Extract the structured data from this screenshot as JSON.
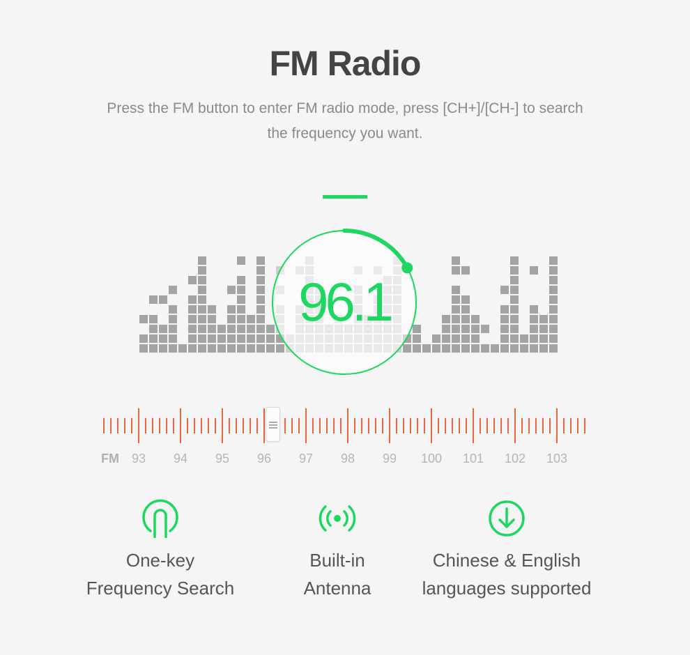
{
  "header": {
    "title": "FM Radio",
    "subtitle": "Press the FM button to enter FM radio mode, press [CH+]/[CH-] to search the frequency you want."
  },
  "colors": {
    "accent_green": "#1ed760",
    "tick_orange": "#e8643a",
    "bar_gray": "#a3a3a3",
    "bar_faded": "#cfcfcf"
  },
  "equalizer": {
    "columns": [
      [
        0,
        1,
        3
      ],
      [
        0,
        1,
        2,
        3,
        5
      ],
      [
        0,
        1,
        2,
        5
      ],
      [
        0,
        1,
        2,
        3,
        4,
        6
      ],
      [
        0
      ],
      [
        0,
        1,
        2,
        3,
        4,
        5,
        7
      ],
      [
        0,
        1,
        2,
        3,
        4,
        5,
        6,
        7,
        8,
        9
      ],
      [
        0,
        1,
        2,
        3,
        4
      ],
      [
        0,
        1,
        2
      ],
      [
        0,
        1,
        2,
        3,
        4,
        6
      ],
      [
        0,
        1,
        2,
        3,
        4,
        5,
        6,
        7,
        9
      ],
      [
        0,
        1,
        2,
        3
      ],
      [
        0,
        1,
        2,
        3,
        4,
        5,
        6,
        7,
        8,
        9
      ],
      [
        0,
        1,
        2
      ],
      [
        0,
        1,
        2,
        3,
        4,
        6,
        8
      ],
      [
        0,
        1
      ],
      [
        0,
        1,
        2,
        3,
        4,
        8
      ],
      [
        0,
        1,
        2,
        3,
        4,
        5,
        6,
        7,
        8,
        9
      ],
      [
        0,
        1,
        2,
        3,
        4,
        5,
        6
      ],
      [
        0,
        1,
        2
      ],
      [
        0,
        1,
        2,
        3
      ],
      [
        0,
        1,
        2
      ],
      [
        0,
        1,
        2,
        3,
        4,
        5,
        6,
        8
      ],
      [
        0,
        1,
        2,
        3
      ],
      [
        0,
        1,
        2,
        3,
        4,
        5,
        8
      ],
      [
        0,
        1,
        2,
        3,
        4,
        5,
        6,
        7
      ],
      [
        0,
        1,
        2,
        3,
        4,
        5,
        6,
        7,
        8,
        9
      ],
      [
        0,
        1
      ],
      [
        0,
        1,
        2
      ],
      [
        0
      ],
      [
        0,
        1
      ],
      [
        0,
        1,
        2,
        3
      ],
      [
        0,
        1,
        2,
        3,
        4,
        5,
        6,
        8,
        9
      ],
      [
        0,
        1,
        2,
        3,
        4,
        5,
        8
      ],
      [
        0,
        1,
        2,
        3
      ],
      [
        0,
        2
      ],
      [
        0
      ],
      [
        0,
        1,
        2,
        3,
        4,
        6
      ],
      [
        0,
        1,
        2,
        3,
        4,
        5,
        6,
        7,
        8,
        9
      ],
      [
        0,
        1
      ],
      [
        0,
        1,
        2,
        3,
        4,
        8
      ],
      [
        0,
        1,
        2,
        3
      ],
      [
        0,
        1,
        2,
        3,
        4,
        5,
        6,
        7,
        8,
        9
      ]
    ]
  },
  "dial": {
    "frequency": "96.1",
    "progress": 0.17
  },
  "tuner": {
    "band_label": "FM",
    "frequencies": [
      "93",
      "94",
      "95",
      "96",
      "97",
      "98",
      "99",
      "100",
      "101",
      "102",
      "103"
    ],
    "current": 96.1
  },
  "features": [
    {
      "icon": "search-signal-icon",
      "line1": "One-key",
      "line2": "Frequency Search"
    },
    {
      "icon": "antenna-icon",
      "line1": "Built-in",
      "line2": "Antenna"
    },
    {
      "icon": "download-arrow-icon",
      "line1": "Chinese & English",
      "line2": "languages supported"
    }
  ]
}
